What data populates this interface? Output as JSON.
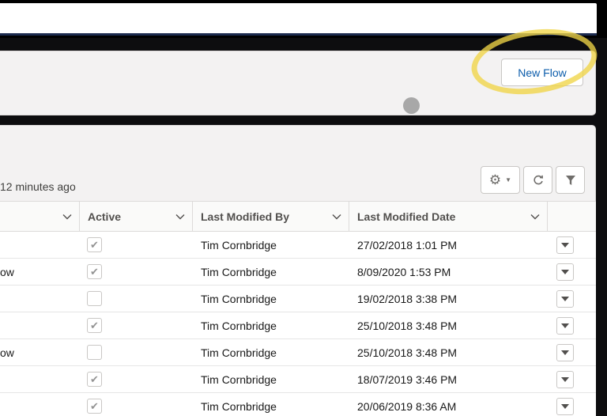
{
  "header": {
    "new_flow_label": "New Flow"
  },
  "list": {
    "updated_text": "12 minutes ago"
  },
  "toolbar": {
    "settings_icon": "gear-icon",
    "refresh_icon": "refresh-icon",
    "filter_icon": "filter-icon"
  },
  "columns": [
    {
      "key": "name",
      "label": ""
    },
    {
      "key": "active",
      "label": "Active"
    },
    {
      "key": "last_modified_by",
      "label": "Last Modified By"
    },
    {
      "key": "last_modified_date",
      "label": "Last Modified Date"
    }
  ],
  "rows": [
    {
      "name": "",
      "active": true,
      "last_modified_by": "Tim Cornbridge",
      "last_modified_date": "27/02/2018 1:01 PM"
    },
    {
      "name": "ow",
      "active": true,
      "last_modified_by": "Tim Cornbridge",
      "last_modified_date": "8/09/2020 1:53 PM"
    },
    {
      "name": "",
      "active": false,
      "last_modified_by": "Tim Cornbridge",
      "last_modified_date": "19/02/2018 3:38 PM"
    },
    {
      "name": "",
      "active": true,
      "last_modified_by": "Tim Cornbridge",
      "last_modified_date": "25/10/2018 3:48 PM"
    },
    {
      "name": "ow",
      "active": false,
      "last_modified_by": "Tim Cornbridge",
      "last_modified_date": "25/10/2018 3:48 PM"
    },
    {
      "name": "",
      "active": true,
      "last_modified_by": "Tim Cornbridge",
      "last_modified_date": "18/07/2019 3:46 PM"
    },
    {
      "name": "",
      "active": true,
      "last_modified_by": "Tim Cornbridge",
      "last_modified_date": "20/06/2019 8:36 AM"
    }
  ],
  "colors": {
    "accent": "#0b5cab",
    "highlight": "#f0d546",
    "nav_border": "#1b2a4e"
  }
}
